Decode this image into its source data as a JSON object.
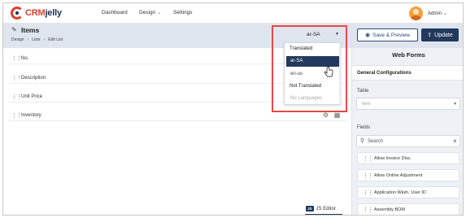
{
  "app": {
    "logo_prefix": "CRM",
    "logo_suffix": "jelly",
    "nav": {
      "dashboard": "Dashboard",
      "design": "Design",
      "settings": "Settings"
    },
    "user": "Admin"
  },
  "header": {
    "title": "Items",
    "breadcrumb": [
      "Design",
      "Lists",
      "Edit List"
    ],
    "language_value": "ar-SA",
    "preview_label": "Save & Preview",
    "update_label": "Update"
  },
  "fields": [
    "No.",
    "Description",
    "Unit Price",
    "Inventory"
  ],
  "js_editor": {
    "badge": "JS",
    "label": "JS Editor"
  },
  "language_dropdown": {
    "translated_label": "Translated",
    "options": [
      {
        "value": "ar-SA",
        "selected": true
      },
      {
        "value": "en-us",
        "selected": false
      }
    ],
    "not_translated_label": "Not Translated",
    "empty_text": "No Languages"
  },
  "right_panel": {
    "title": "Web Forms",
    "section": "General Configurations",
    "table_label": "Table",
    "table_placeholder": "Item",
    "fields_label": "Fields",
    "search_placeholder": "Search",
    "field_items": [
      "Allow Invoice Disc.",
      "Allow Online Adjustment",
      "Application Wksh. User ID",
      "Assembly BOM"
    ]
  },
  "colors": {
    "accent": "#23395d",
    "brand_red": "#d9412f",
    "highlight": "#e64a45",
    "header_bg": "#dfe5ef"
  }
}
